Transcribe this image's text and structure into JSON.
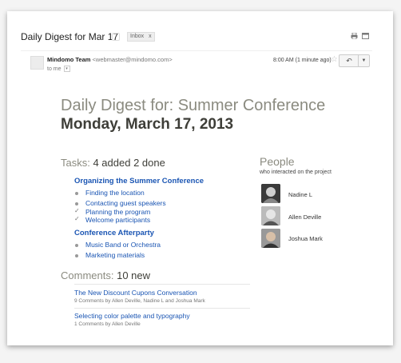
{
  "email": {
    "subject": "Daily Digest for Mar 17",
    "label": "Inbox",
    "label_close": "x",
    "sender_name": "Mindomo Team",
    "sender_email": "<webmaster@mindomo.com>",
    "to": "to me",
    "time": "8:00 AM (1 minute ago)"
  },
  "digest": {
    "title": "Daily Digest for: Summer Conference",
    "date": "Monday, March 17, 2013"
  },
  "tasks": {
    "heading": "Tasks:",
    "summary": "4 added 2 done",
    "groups": [
      {
        "title": "Organizing the Summer Conference",
        "items": [
          {
            "label": "Finding the location",
            "done": false
          },
          {
            "label": "Contacting guest speakers",
            "done": false
          },
          {
            "label": "Planning the program",
            "done": true
          },
          {
            "label": "Welcome participants",
            "done": true
          }
        ]
      },
      {
        "title": "Conference Afterparty",
        "items": [
          {
            "label": "Music Band or Orchestra",
            "done": false
          },
          {
            "label": "Marketing materials",
            "done": false
          }
        ]
      }
    ]
  },
  "comments": {
    "heading": "Comments:",
    "count": "10 new",
    "items": [
      {
        "title": "The New Discount Cupons Conversation",
        "meta": "9 Comments by Allen Deville, Nadine L and Joshua Mark"
      },
      {
        "title": "Selecting color palette and typography",
        "meta": "1 Comments by Allen Deville"
      }
    ]
  },
  "people": {
    "heading": "People",
    "subtitle": "who interacted on the project",
    "list": [
      {
        "name": "Nadine L"
      },
      {
        "name": "Allen Deville"
      },
      {
        "name": "Joshua Mark"
      }
    ]
  }
}
